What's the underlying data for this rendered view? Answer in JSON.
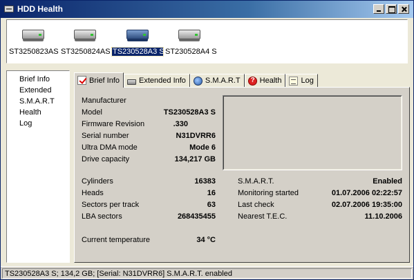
{
  "window": {
    "title": "HDD Health"
  },
  "drives": [
    {
      "label": "ST3250823AS"
    },
    {
      "label": "ST3250824AS"
    },
    {
      "label": "TS230528A3 S"
    },
    {
      "label": "ST230528A4 S"
    }
  ],
  "left_list": [
    "Brief Info",
    "Extended",
    "S.M.A.R.T",
    "Health",
    "Log"
  ],
  "tabs": [
    "Brief Info",
    "Extended Info",
    "S.M.A.R.T",
    "Health",
    "Log"
  ],
  "brief": {
    "manufacturer_label": "Manufacturer",
    "model_label": "Model",
    "model": "TS230528A3 S",
    "firmware_label": "Firmware Revision",
    "firmware": ".330",
    "serial_label": "Serial number",
    "serial": "N31DVRR6",
    "udma_label": "Ultra DMA mode",
    "udma": "Mode 6",
    "capacity_label": "Drive capacity",
    "capacity": "134,217 GB",
    "cylinders_label": "Cylinders",
    "cylinders": "16383",
    "heads_label": "Heads",
    "heads": "16",
    "spt_label": "Sectors per track",
    "spt": "63",
    "lba_label": "LBA sectors",
    "lba": "268435455",
    "temp_label": "Current temperature",
    "temp": "34 °C",
    "smart_label": "S.M.A.R.T.",
    "smart": "Enabled",
    "monitoring_label": "Monitoring started",
    "monitoring": "01.07.2006 02:22:57",
    "lastcheck_label": "Last check",
    "lastcheck": "02.07.2006 19:35:00",
    "tec_label": "Nearest T.E.C.",
    "tec": "11.10.2006"
  },
  "status": {
    "text": "TS230528A3 S;  134,2 GB;  [Serial: N31DVRR6]   S.M.A.R.T. enabled"
  },
  "colors": {
    "titlebar": "#0a246a",
    "face": "#d4d0c8",
    "selection": "#0a246a"
  }
}
